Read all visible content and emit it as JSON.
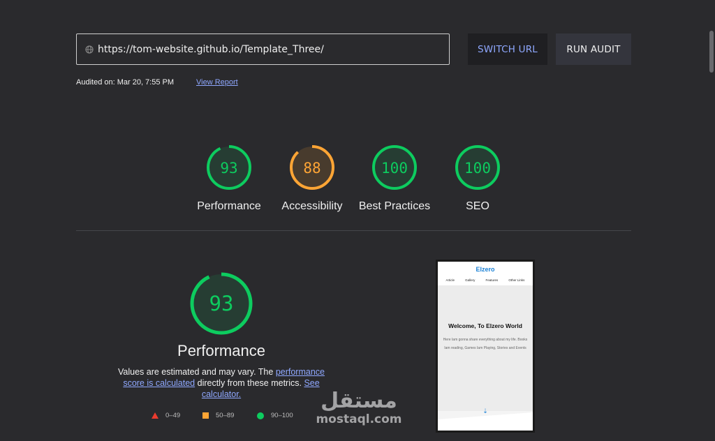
{
  "url_bar": {
    "value": "https://tom-website.github.io/Template_Three/"
  },
  "buttons": {
    "switch_url": "SWITCH URL",
    "run_audit": "RUN AUDIT"
  },
  "audit": {
    "audited_on": "Audited on: Mar 20, 7:55 PM",
    "view_report": "View Report"
  },
  "colors": {
    "pass": "#0dcc5f",
    "average": "#ffa535",
    "fail": "#eb3b2e",
    "link": "#8fa8ff"
  },
  "scores": [
    {
      "value": "93",
      "label": "Performance",
      "status": "pass",
      "fraction": 0.93
    },
    {
      "value": "88",
      "label": "Accessibility",
      "status": "average",
      "fraction": 0.88
    },
    {
      "value": "100",
      "label": "Best Practices",
      "status": "pass",
      "fraction": 1.0
    },
    {
      "value": "100",
      "label": "SEO",
      "status": "pass",
      "fraction": 1.0
    }
  ],
  "detail": {
    "score": "93",
    "fraction": 0.93,
    "title": "Performance",
    "desc_part1": "Values are estimated and may vary. The ",
    "desc_link1": "performance score is calculated",
    "desc_part2": " directly from these metrics. ",
    "desc_link2": "See calculator.",
    "legend": [
      {
        "range": "0–49",
        "icon": "triangle"
      },
      {
        "range": "50–89",
        "icon": "square"
      },
      {
        "range": "90–100",
        "icon": "circle"
      }
    ]
  },
  "screenshot": {
    "logo": "Elzero",
    "nav": [
      "Article",
      "Gallery",
      "Features",
      "Other Links"
    ],
    "heading": "Welcome, To Elzero World",
    "text": "Here Iam gonna share everything about my life. Books Iam reading, Games Iam Playing, Stories and Events"
  },
  "watermark": {
    "arabic": "مستقل",
    "latin": "mostaql.com"
  }
}
